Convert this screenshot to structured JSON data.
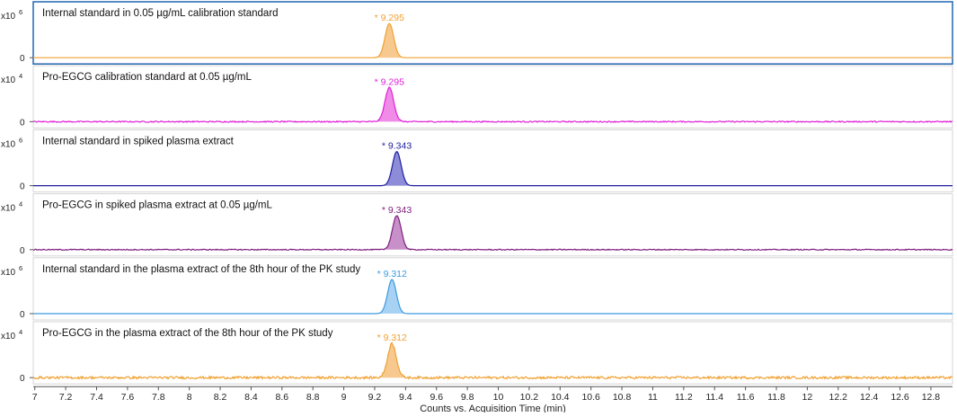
{
  "chart_data": {
    "type": "line",
    "xlabel": "Counts vs. Acquisition Time (min)",
    "xlim": [
      6.99,
      12.94
    ],
    "xticks": [
      "7",
      "7.2",
      "7.4",
      "7.6",
      "7.8",
      "8",
      "8.2",
      "8.4",
      "8.6",
      "8.8",
      "9",
      "9.2",
      "9.4",
      "9.6",
      "9.8",
      "10",
      "10.2",
      "10.4",
      "10.6",
      "10.8",
      "11",
      "11.2",
      "11.4",
      "11.6",
      "11.8",
      "12",
      "12.2",
      "12.4",
      "12.6",
      "12.8"
    ],
    "grid": false,
    "panels": [
      {
        "title": "Internal standard in 0.05 µg/mL calibration standard",
        "scale_label": "x10",
        "exponent": "6",
        "zero_label": "0",
        "peak_label": "* 9.295",
        "peak_time": 9.295,
        "color": "#f0a030",
        "fill": "#f7c98f",
        "noise": 0.0,
        "selected": true
      },
      {
        "title": "Pro-EGCG calibration standard at 0.05 µg/mL",
        "scale_label": "x10",
        "exponent": "4",
        "zero_label": "0",
        "peak_label": "* 9.295",
        "peak_time": 9.295,
        "color": "#e020d8",
        "fill": "#f08ce8",
        "noise": 0.06,
        "selected": false
      },
      {
        "title": "Internal standard in spiked plasma extract",
        "scale_label": "x10",
        "exponent": "6",
        "zero_label": "0",
        "peak_label": "* 9.343",
        "peak_time": 9.343,
        "color": "#2020a0",
        "fill": "#8c8cd8",
        "noise": 0.0,
        "selected": false
      },
      {
        "title": "Pro-EGCG in spiked plasma extract at 0.05 µg/mL",
        "scale_label": "x10",
        "exponent": "4",
        "zero_label": "0",
        "peak_label": "* 9.343",
        "peak_time": 9.343,
        "color": "#802080",
        "fill": "#c890c8",
        "noise": 0.05,
        "selected": false
      },
      {
        "title": "Internal standard in the plasma extract of the 8th hour of the PK study",
        "scale_label": "x10",
        "exponent": "6",
        "zero_label": "0",
        "peak_label": "* 9.312",
        "peak_time": 9.312,
        "color": "#3a9ae0",
        "fill": "#a8d2f4",
        "noise": 0.0,
        "selected": false
      },
      {
        "title": "Pro-EGCG in the plasma extract of the 8th hour of the PK study",
        "scale_label": "x10",
        "exponent": "4",
        "zero_label": "0",
        "peak_label": "* 9.312",
        "peak_time": 9.312,
        "color": "#f0a030",
        "fill": "#f7c98f",
        "noise": 0.12,
        "selected": false
      }
    ]
  }
}
